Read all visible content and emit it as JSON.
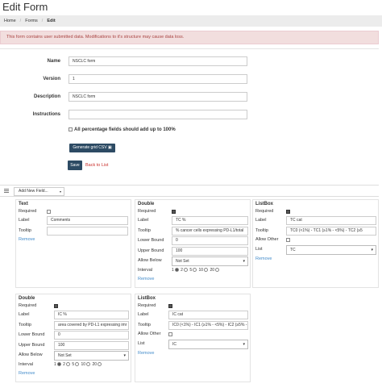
{
  "page_title": "Edit Form",
  "breadcrumb": [
    "Home",
    "Forms",
    "Edit"
  ],
  "alert": "This form contains user submitted data. Modifications to it's structure may cause data loss.",
  "form": {
    "name_label": "Name",
    "name_value": "NSCLC form",
    "version_label": "Version",
    "version_value": "1",
    "description_label": "Description",
    "description_value": "NSCLC form",
    "instructions_label": "Instructions",
    "instructions_value": "",
    "percent_check_label": "All percentage fields should add up to 100%",
    "csv_button": "Generate grid CSV ▣",
    "save_button": "Save",
    "back_link": "Back to List"
  },
  "toolbar": {
    "add_field": "Add New Field..."
  },
  "cards": {
    "text": {
      "title": "Text",
      "required": "Required",
      "label": "Label",
      "label_value": "Comments",
      "tooltip": "Tooltip",
      "tooltip_value": "",
      "remove": "Remove"
    },
    "double1": {
      "title": "Double",
      "required": "Required",
      "label": "Label",
      "label_value": "TC %",
      "tooltip": "Tooltip",
      "tooltip_value": "% cancer cells expressing PD-L1/total",
      "lower": "Lower Bound",
      "lower_value": "0",
      "upper": "Upper Bound",
      "upper_value": "100",
      "allow": "Allow Below",
      "allow_value": "Not Set",
      "interval": "Interval",
      "interval_options": [
        "1",
        "2",
        "5",
        "10",
        "20"
      ],
      "remove": "Remove"
    },
    "listbox1": {
      "title": "ListBox",
      "required": "Required",
      "label": "Label",
      "label_value": "TC cat",
      "tooltip": "Tooltip",
      "tooltip_value": "TC0 (<1%) - TC1 (≥1% - <5%) - TC2 (≥5",
      "allow_other": "Allow Other",
      "list": "List",
      "list_value": "TC",
      "remove": "Remove"
    },
    "double2": {
      "title": "Double",
      "required": "Required",
      "label": "Label",
      "label_value": "IC %",
      "tooltip": "Tooltip",
      "tooltip_value": "area covered by PD-L1 expressing imr",
      "lower": "Lower Bound",
      "lower_value": "0",
      "upper": "Upper Bound",
      "upper_value": "100",
      "allow": "Allow Below",
      "allow_value": "Not Set",
      "interval": "Interval",
      "interval_options": [
        "1",
        "2",
        "5",
        "10",
        "20"
      ],
      "remove": "Remove"
    },
    "listbox2": {
      "title": "ListBox",
      "required": "Required",
      "label": "Label",
      "label_value": "IC cat",
      "tooltip": "Tooltip",
      "tooltip_value": "IC0 (<1%) - IC1 (≥1% - <5%) - IC2 (≥5% -",
      "allow_other": "Allow Other",
      "list": "List",
      "list_value": "IC",
      "remove": "Remove"
    }
  }
}
